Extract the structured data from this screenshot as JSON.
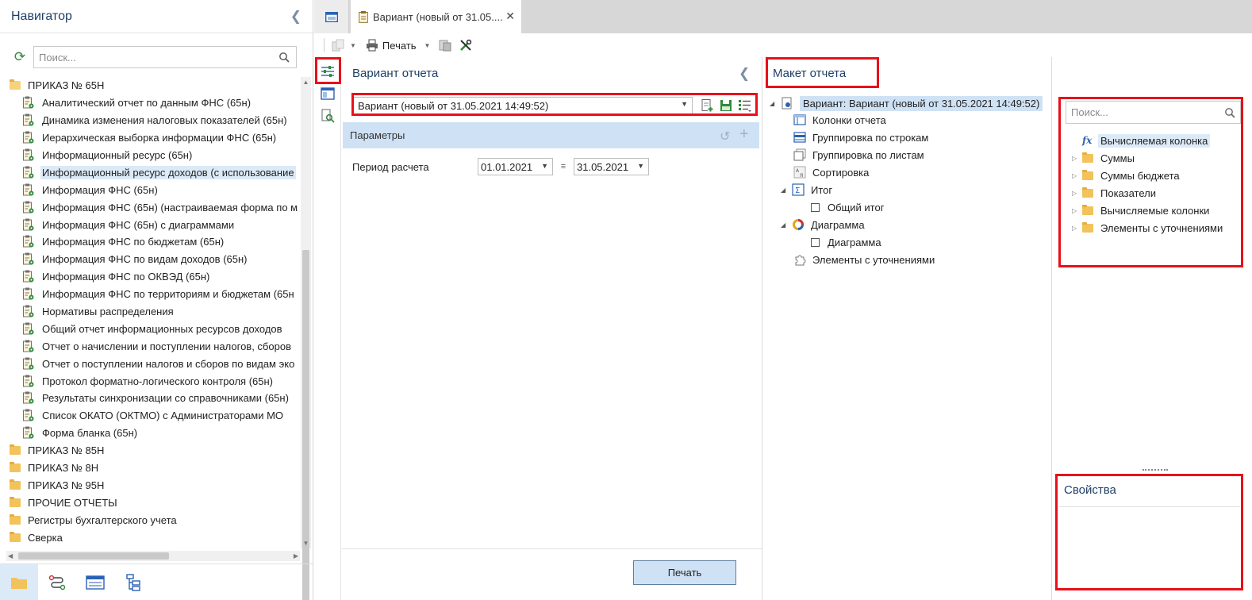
{
  "navigator": {
    "title": "Навигатор",
    "search_placeholder": "Поиск...",
    "tree": [
      {
        "type": "folder",
        "open": true,
        "label": "ПРИКАЗ № 65Н"
      },
      {
        "type": "report",
        "label": "Аналитический отчет по данным ФНС (65н)"
      },
      {
        "type": "report",
        "label": "Динамика изменения налоговых показателей (65н)"
      },
      {
        "type": "report",
        "label": "Иерархическая выборка информации ФНС (65н)"
      },
      {
        "type": "report",
        "label": "Информационный ресурс (65н)"
      },
      {
        "type": "report",
        "label": "Информационный ресурс доходов (с использование",
        "selected": true
      },
      {
        "type": "report",
        "label": "Информация ФНС (65н)"
      },
      {
        "type": "report",
        "label": "Информация ФНС (65н) (настраиваемая форма по м"
      },
      {
        "type": "report",
        "label": "Информация ФНС (65н) с диаграммами"
      },
      {
        "type": "report",
        "label": "Информация ФНС по бюджетам (65н)"
      },
      {
        "type": "report",
        "label": "Информация ФНС по видам доходов (65н)"
      },
      {
        "type": "report",
        "label": "Информация ФНС по ОКВЭД (65н)"
      },
      {
        "type": "report",
        "label": "Информация ФНС по территориям и бюджетам (65н"
      },
      {
        "type": "report",
        "label": "Нормативы распределения"
      },
      {
        "type": "report",
        "label": "Общий отчет информационных ресурсов доходов"
      },
      {
        "type": "report",
        "label": "Отчет о начислении и поступлении налогов, сборов"
      },
      {
        "type": "report",
        "label": "Отчет о поступлении налогов и сборов по видам эко"
      },
      {
        "type": "report",
        "label": "Протокол форматно-логического контроля (65н)"
      },
      {
        "type": "report",
        "label": "Результаты синхронизации со справочниками (65н)"
      },
      {
        "type": "report",
        "label": "Список ОКАТО (ОКТМО) с Администраторами МО"
      },
      {
        "type": "report",
        "label": "Форма бланка (65н)"
      },
      {
        "type": "folder",
        "label": "ПРИКАЗ № 85Н"
      },
      {
        "type": "folder",
        "label": "ПРИКАЗ № 8Н"
      },
      {
        "type": "folder",
        "label": "ПРИКАЗ № 95Н"
      },
      {
        "type": "folder",
        "label": "ПРОЧИЕ ОТЧЕТЫ"
      },
      {
        "type": "folder",
        "label": "Регистры бухгалтерского учета"
      },
      {
        "type": "folder",
        "label": "Сверка"
      }
    ]
  },
  "tabs": {
    "active_label": "Вариант (новый от 31.05...."
  },
  "toolbar": {
    "print_label": "Печать"
  },
  "variant_panel": {
    "title": "Вариант отчета",
    "selected_variant": "Вариант (новый от 31.05.2021 14:49:52)",
    "params_label": "Параметры",
    "period_label": "Период расчета",
    "date_from": "01.01.2021",
    "date_to": "31.05.2021",
    "print_button": "Печать"
  },
  "layout_panel": {
    "title": "Макет отчета",
    "root": "Вариант: Вариант (новый от 31.05.2021 14:49:52)",
    "items": {
      "columns": "Колонки отчета",
      "row_grouping": "Группировка по строкам",
      "sheet_grouping": "Группировка по листам",
      "sorting": "Сортировка",
      "total": "Итог",
      "grand_total": "Общий итог",
      "chart_group": "Диаграмма",
      "chart": "Диаграмма",
      "refinements": "Элементы с уточнениями"
    }
  },
  "fields_panel": {
    "search_placeholder": "Поиск...",
    "items": [
      {
        "label": "Вычисляемая колонка",
        "kind": "fx",
        "selected": true
      },
      {
        "label": "Суммы",
        "kind": "folder"
      },
      {
        "label": "Суммы бюджета",
        "kind": "folder"
      },
      {
        "label": "Показатели",
        "kind": "folder"
      },
      {
        "label": "Вычисляемые колонки",
        "kind": "folder"
      },
      {
        "label": "Элементы с уточнениями",
        "kind": "folder"
      }
    ]
  },
  "properties_panel": {
    "title": "Свойства"
  },
  "colors": {
    "accent_blue": "#1e3f66",
    "selection": "#dceaf8",
    "highlight_red": "#e8101a",
    "folder": "#f2c25b"
  }
}
